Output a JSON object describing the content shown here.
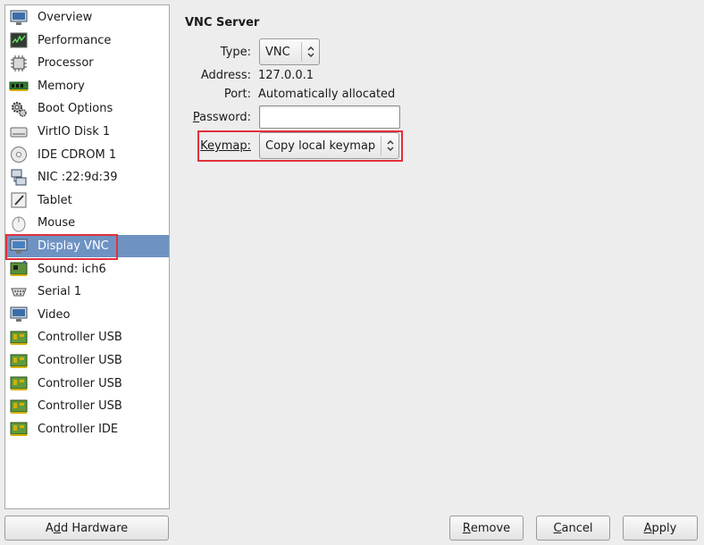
{
  "sidebar": {
    "items": [
      {
        "label": "Overview",
        "icon": "monitor-icon"
      },
      {
        "label": "Performance",
        "icon": "performance-chart-icon"
      },
      {
        "label": "Processor",
        "icon": "processor-chip-icon"
      },
      {
        "label": "Memory",
        "icon": "memory-module-icon"
      },
      {
        "label": "Boot Options",
        "icon": "gears-icon"
      },
      {
        "label": "VirtIO Disk 1",
        "icon": "hard-disk-icon"
      },
      {
        "label": "IDE CDROM 1",
        "icon": "cdrom-icon"
      },
      {
        "label": "NIC :22:9d:39",
        "icon": "network-icon"
      },
      {
        "label": "Tablet",
        "icon": "tablet-icon"
      },
      {
        "label": "Mouse",
        "icon": "mouse-icon"
      },
      {
        "label": "Display VNC",
        "icon": "display-icon",
        "selected": true
      },
      {
        "label": "Sound: ich6",
        "icon": "sound-card-icon"
      },
      {
        "label": "Serial 1",
        "icon": "serial-port-icon"
      },
      {
        "label": "Video",
        "icon": "video-monitor-icon"
      },
      {
        "label": "Controller USB",
        "icon": "controller-card-icon"
      },
      {
        "label": "Controller USB",
        "icon": "controller-card-icon"
      },
      {
        "label": "Controller USB",
        "icon": "controller-card-icon"
      },
      {
        "label": "Controller USB",
        "icon": "controller-card-icon"
      },
      {
        "label": "Controller IDE",
        "icon": "controller-card-icon"
      }
    ]
  },
  "vnc": {
    "title": "VNC Server",
    "type_label": "Type:",
    "type_value": "VNC",
    "address_label": "Address:",
    "address_value": "127.0.0.1",
    "port_label": "Port:",
    "port_value": "Automatically allocated",
    "password_label": "Password:",
    "password_value": "",
    "keymap_label": "Keymap:",
    "keymap_value": "Copy local keymap"
  },
  "buttons": {
    "add_hardware": {
      "pre": "A",
      "mnem": "d",
      "post": "d Hardware"
    },
    "remove": {
      "pre": "",
      "mnem": "R",
      "post": "emove"
    },
    "cancel": {
      "pre": "",
      "mnem": "C",
      "post": "ancel"
    },
    "apply": {
      "pre": "",
      "mnem": "A",
      "post": "pply"
    }
  },
  "colors": {
    "selection": "#6e93c3",
    "highlight": "#e0313a"
  }
}
